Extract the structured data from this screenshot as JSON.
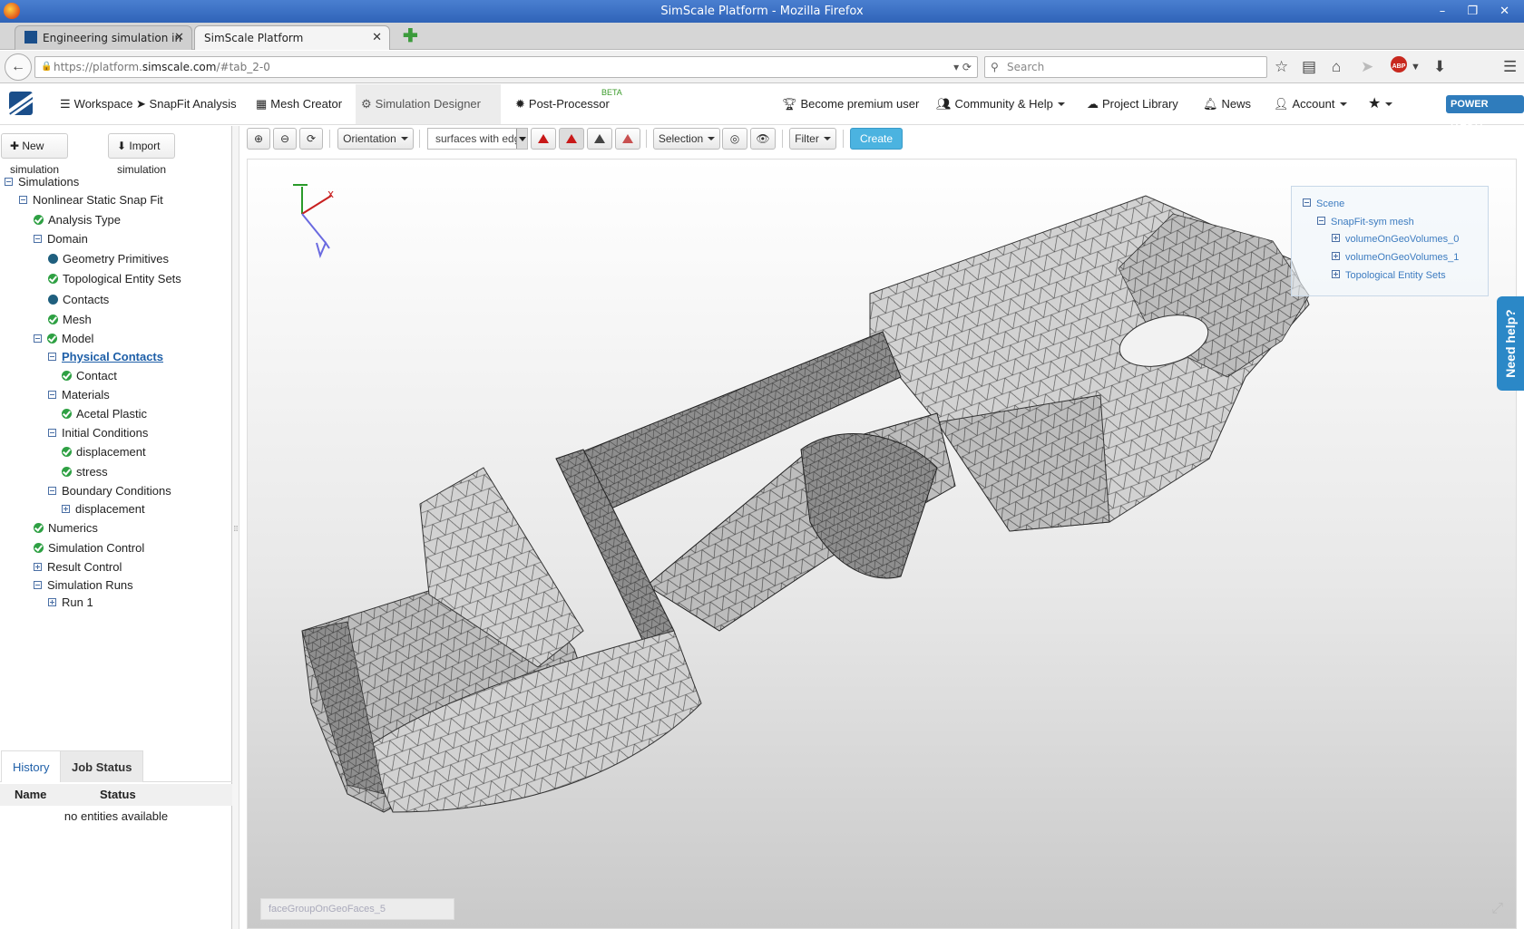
{
  "window": {
    "title": "SimScale Platform - Mozilla Firefox",
    "controls": "– ❐ ✕"
  },
  "browser": {
    "tabs": [
      {
        "label": "Engineering simulation in yo..."
      },
      {
        "label": "SimScale Platform"
      }
    ],
    "url_prefix": "https://platform.",
    "url_host": "simscale.com",
    "url_path": "/#tab_2-0",
    "search_placeholder": "Search"
  },
  "app": {
    "nav": {
      "workspace": "Workspace ➤ SnapFit Analysis",
      "mesh_creator": "Mesh Creator",
      "simulation_designer": "Simulation Designer",
      "post_processor": "Post-Processor",
      "beta": "BETA",
      "premium": "Become premium user",
      "community": "Community & Help",
      "project_library": "Project Library",
      "news": "News",
      "account": "Account",
      "power": "POWER (TEST)"
    },
    "left": {
      "new_simulation": "New simulation",
      "import_simulation": "Import simulation",
      "tree": {
        "simulations": "Simulations",
        "nonlinear": "Nonlinear Static Snap Fit",
        "analysis_type": "Analysis Type",
        "domain": "Domain",
        "geometry_primitives": "Geometry Primitives",
        "topological_entity_sets": "Topological Entity Sets",
        "contacts": "Contacts",
        "mesh": "Mesh",
        "model": "Model",
        "physical_contacts": "Physical Contacts",
        "contact": "Contact",
        "materials": "Materials",
        "acetal_plastic": "Acetal Plastic",
        "initial_conditions": "Initial Conditions",
        "displacement": "displacement",
        "stress": "stress",
        "boundary_conditions": "Boundary Conditions",
        "bc_displacement": "displacement",
        "numerics": "Numerics",
        "simulation_control": "Simulation Control",
        "result_control": "Result Control",
        "simulation_runs": "Simulation Runs",
        "run1": "Run 1"
      },
      "job_tabs": {
        "history": "History",
        "job_status": "Job Status"
      },
      "job_table": {
        "name": "Name",
        "status": "Status",
        "empty": "no entities available"
      }
    },
    "viewer": {
      "orientation": "Orientation",
      "render_mode": "surfaces with edges",
      "selection": "Selection",
      "filter": "Filter",
      "create_set": "Create set",
      "scene": {
        "scene": "Scene",
        "mesh": "SnapFit-sym mesh",
        "vol0": "volumeOnGeoVolumes_0",
        "vol1": "volumeOnGeoVolumes_1",
        "topo": "Topological Entity Sets"
      },
      "face_group": "faceGroupOnGeoFaces_5",
      "need_help": "Need help?"
    }
  }
}
